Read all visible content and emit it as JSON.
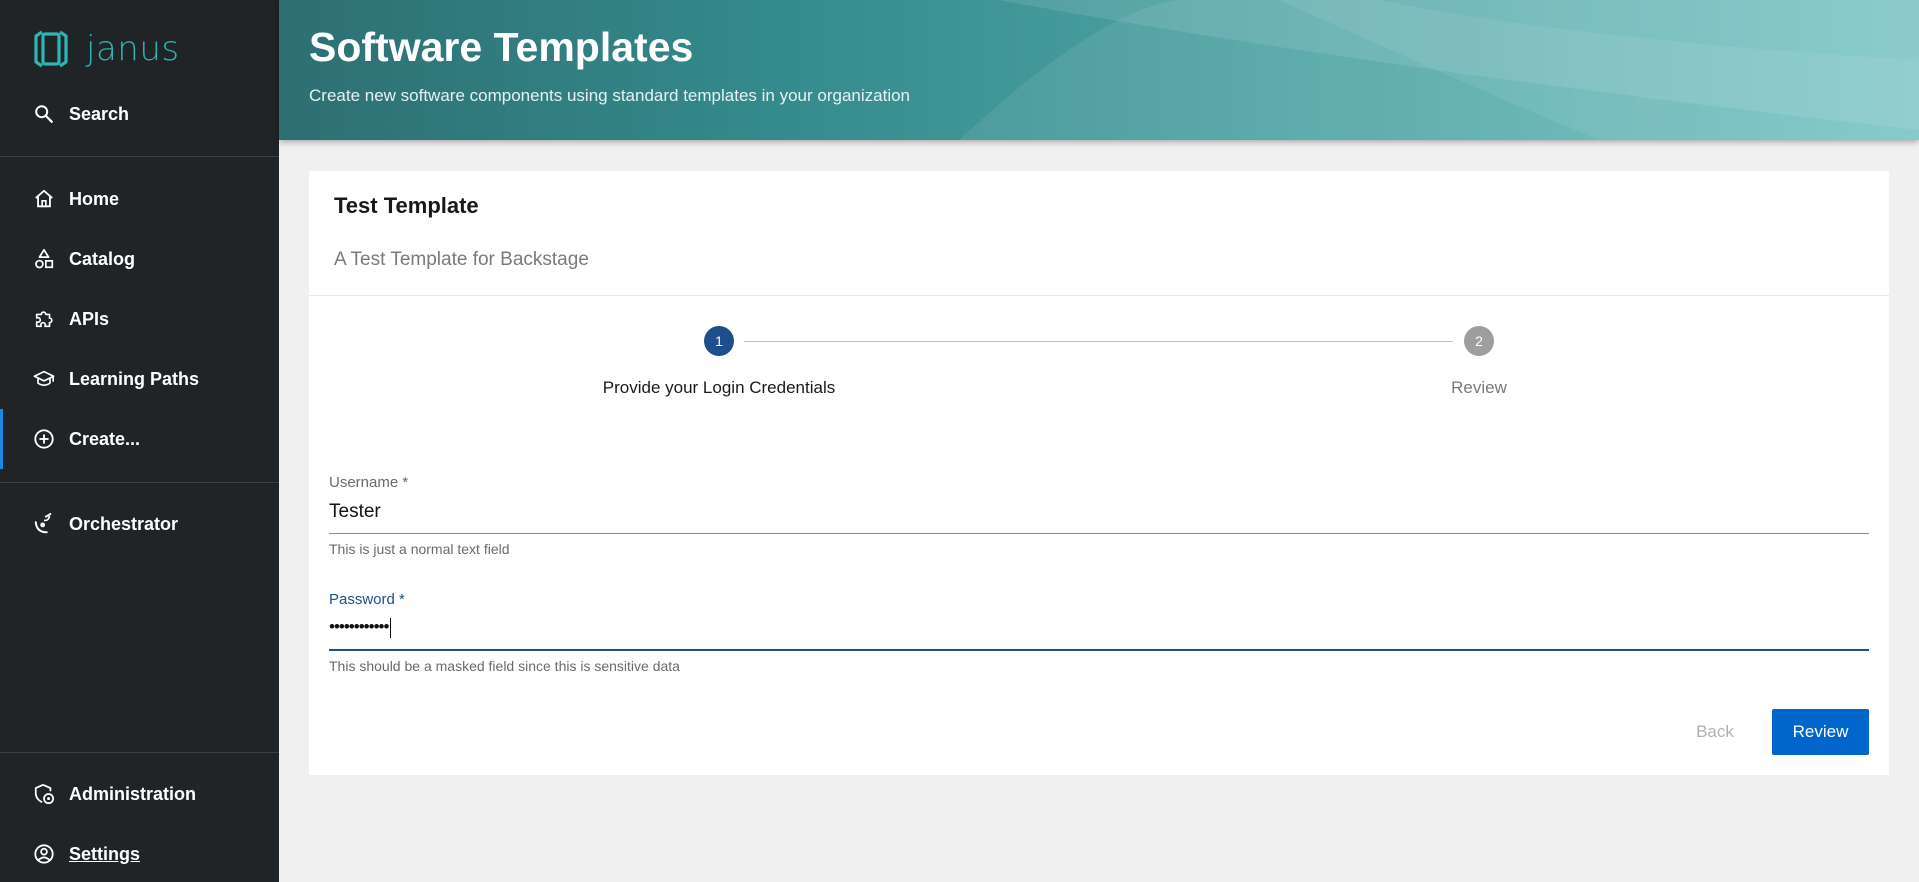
{
  "app": {
    "logo_text": "janus"
  },
  "sidebar": {
    "search_label": "Search",
    "items": [
      {
        "label": "Home",
        "icon": "home-icon"
      },
      {
        "label": "Catalog",
        "icon": "catalog-icon"
      },
      {
        "label": "APIs",
        "icon": "puzzle-icon"
      },
      {
        "label": "Learning Paths",
        "icon": "school-icon"
      },
      {
        "label": "Create...",
        "icon": "add-circle-icon",
        "active": true
      },
      {
        "label": "Orchestrator",
        "icon": "orchestrator-icon"
      }
    ],
    "bottom_items": [
      {
        "label": "Administration",
        "icon": "admin-icon"
      },
      {
        "label": "Settings",
        "icon": "account-circle-icon"
      }
    ]
  },
  "header": {
    "title": "Software Templates",
    "subtitle": "Create new software components using standard templates in your organization"
  },
  "template": {
    "title": "Test Template",
    "description": "A Test Template for Backstage"
  },
  "stepper": {
    "steps": [
      {
        "number": "1",
        "label": "Provide your Login Credentials",
        "active": true
      },
      {
        "number": "2",
        "label": "Review",
        "active": false
      }
    ]
  },
  "form": {
    "username": {
      "label": "Username",
      "required_marker": "*",
      "value": "Tester",
      "help": "This is just a normal text field"
    },
    "password": {
      "label": "Password",
      "required_marker": "*",
      "value": "••••••••••••",
      "help": "This should be a masked field since this is sensitive data"
    }
  },
  "actions": {
    "back_label": "Back",
    "review_label": "Review"
  },
  "colors": {
    "sidebar_bg": "#202427",
    "accent": "#0066cc",
    "step_active": "#1f4e8c",
    "step_inactive": "#9e9e9e",
    "focused_field": "#1f4e8c",
    "logo": "#2fb3b3"
  }
}
